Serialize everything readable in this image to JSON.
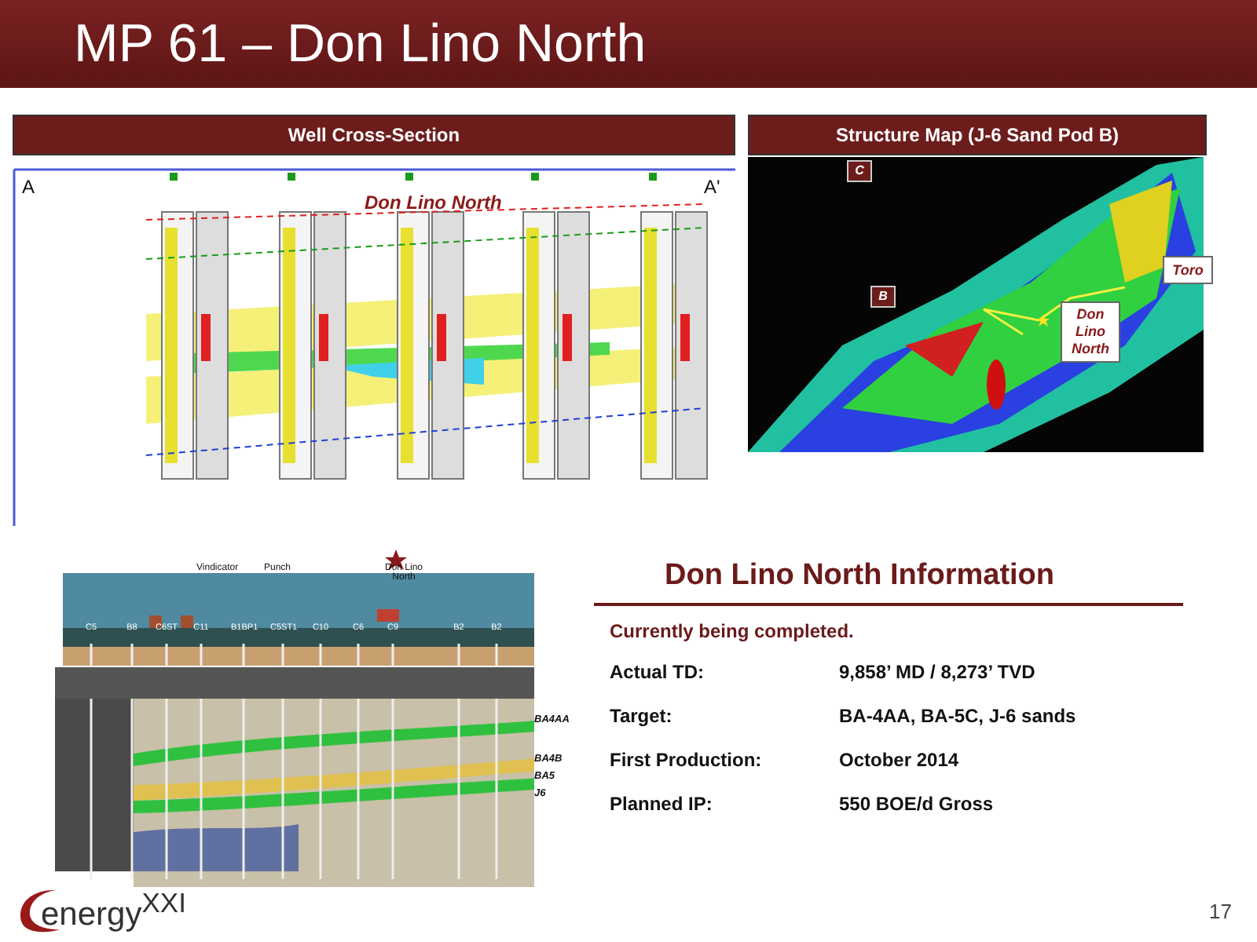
{
  "header": {
    "title": "MP 61 – Don Lino North"
  },
  "cross_section": {
    "heading": "Well Cross-Section",
    "label": "Don Lino North",
    "end_labels": [
      "A",
      "A'"
    ]
  },
  "structure_map": {
    "heading": "Structure Map (J-6 Sand Pod B)",
    "area_labels": [
      "C",
      "B"
    ],
    "callouts": [
      "Toro",
      "Don Lino North"
    ]
  },
  "block_diagram": {
    "platform_labels": [
      "Vindicator",
      "Punch",
      "Don Lino North"
    ],
    "wells": [
      "C5",
      "B8",
      "C6ST",
      "C11",
      "B1BP1",
      "C5ST1",
      "C10",
      "C6",
      "C9",
      "B2",
      "B2"
    ],
    "sands": [
      "BA4AA",
      "BA4B",
      "BA5",
      "J6"
    ]
  },
  "info": {
    "title": "Don Lino North Information",
    "status": "Currently being completed.",
    "rows": [
      {
        "label": "Actual TD:",
        "value": "9,858’ MD / 8,273’ TVD"
      },
      {
        "label": "Target:",
        "value": "BA-4AA, BA-5C, J-6 sands"
      },
      {
        "label": "First Production:",
        "value": "October 2014"
      },
      {
        "label": "Planned IP:",
        "value": "550 BOE/d Gross"
      }
    ]
  },
  "logo": {
    "text": "energy$^{XXI}$"
  },
  "page_number": "17"
}
